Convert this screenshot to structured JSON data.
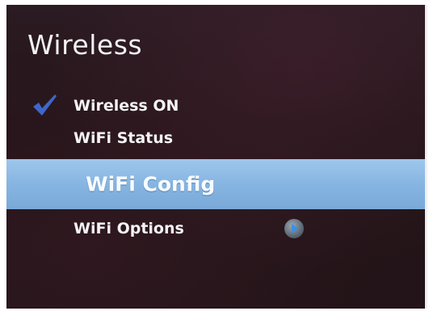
{
  "menu": {
    "title": "Wireless",
    "items": [
      {
        "label": "Wireless ON",
        "checked": true,
        "icon": "checkmark-icon"
      },
      {
        "label": "WiFi Status"
      },
      {
        "label": "WiFi Config",
        "selected": true
      },
      {
        "label": "WiFi Options",
        "icon": "submenu-arrow-icon"
      }
    ]
  },
  "colors": {
    "background": "#241519",
    "highlight": "#8cb9e4",
    "text": "#f4f4f4",
    "checkmark": "#3f66c9"
  }
}
